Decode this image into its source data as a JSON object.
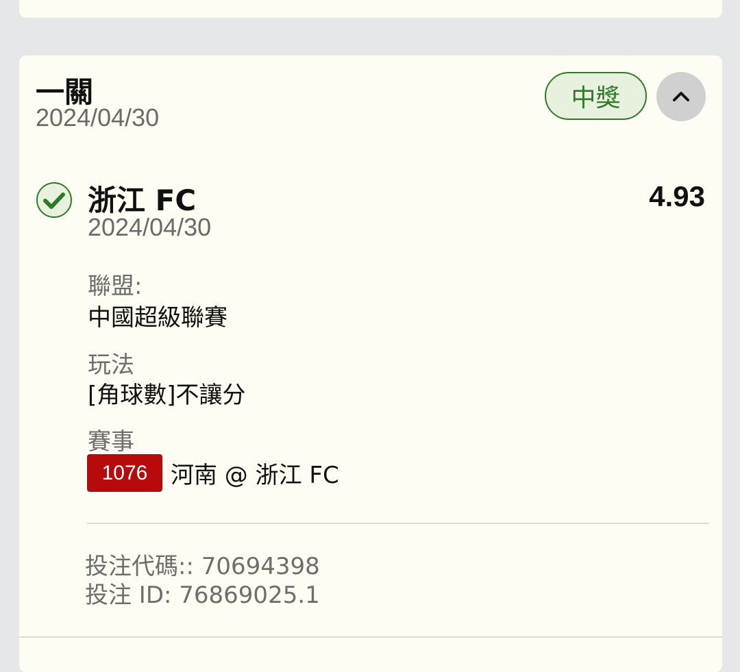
{
  "bet": {
    "type": "一關",
    "date": "2024/04/30",
    "status": "中獎"
  },
  "selection": {
    "name": "浙江 FC",
    "date": "2024/04/30",
    "odds": "4.93",
    "league_label": "聯盟:",
    "league_value": "中國超級聯賽",
    "market_label": "玩法",
    "market_value": "[角球數]不讓分",
    "event_label": "賽事",
    "event_number": "1076",
    "event_name": "河南 @ 浙江 FC"
  },
  "codes": {
    "bet_code": "投注代碼:: 70694398",
    "bet_id": "投注 ID: 76869025.1"
  },
  "colors": {
    "win_green": "#2e7a26",
    "event_red": "#b70b0b",
    "card_bg": "#fdfdf4"
  },
  "icons": {
    "status": "check-circle-icon",
    "collapse": "chevron-up-icon"
  }
}
